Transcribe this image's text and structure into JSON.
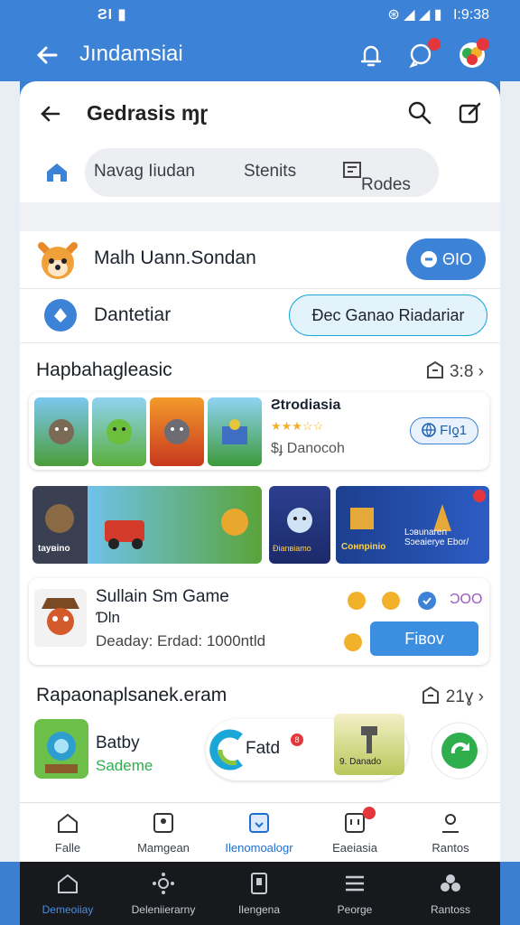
{
  "status": {
    "left": "ƧI ▮",
    "time": "Ι:9:38",
    "icons": "⊛ ◢ ◢ ▮"
  },
  "appbar": {
    "title": "Jındamsiai"
  },
  "sub": {
    "title": "Gedrasis ɱɽ"
  },
  "chips": [
    "Navag Iiudan",
    "Stenits",
    "Rodes"
  ],
  "account": {
    "name": "Malh Uann.Sondan",
    "button": "ΘΙΟ"
  },
  "info": {
    "label": "Dantetiar",
    "button": "Ɖec Ganao Riadariar"
  },
  "section1": {
    "title": "Hapbahagleasic",
    "meta": "3:8"
  },
  "feature": {
    "title": "Ƨtrodiasia",
    "rating": "★★★☆☆",
    "price": "$ɟ Danocoh",
    "button": "FIƍ1"
  },
  "banners": [
    {
      "caption": "tayʙino"
    },
    {
      "caption": "Ɖianʙiamo"
    },
    {
      "caption": "Coнnpinio"
    },
    {
      "caption": "Lɔʙunaren\nSɔeaierye Ebor/"
    }
  ],
  "game": {
    "title": "Sullain Sm Game",
    "subtitle": "Ɗln",
    "detail": "Deaday: Erdad: 1000ntld",
    "count": "ƆΟΟ",
    "button": "Fiʙov"
  },
  "section2": {
    "title": "Rapaonaplsanek.eram",
    "meta": "21ɣ"
  },
  "item": {
    "name": "Batby",
    "sub": "Sademe",
    "toast": "Fatd",
    "toast_badge": "8",
    "tile_caption": "9. Danado"
  },
  "nav": [
    "Falle",
    "Mamgean",
    "Ilenomoalogr",
    "Eaeiasia",
    "Rantos"
  ],
  "sysnav": [
    "Demeoiiay",
    "Deleniierarny",
    "Ilengena",
    "Peorge",
    "Rantoss"
  ],
  "colors": {
    "primary": "#3c82d6",
    "accent": "#1aa7d8",
    "green": "#2fae4e",
    "badge": "#e5363b"
  }
}
